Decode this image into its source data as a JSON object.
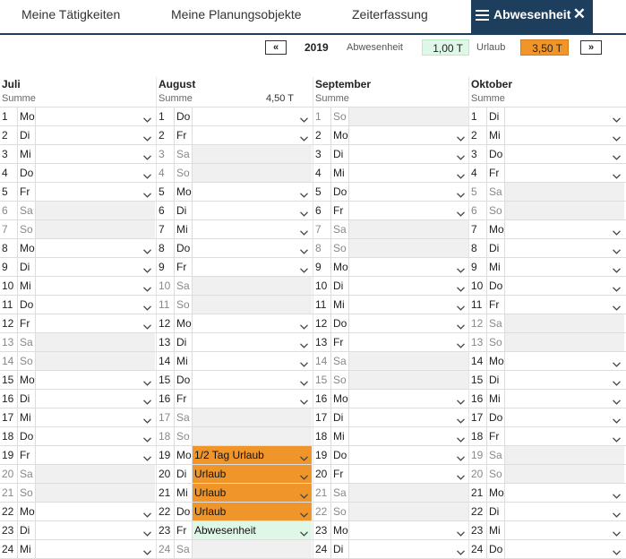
{
  "tabs": [
    {
      "label": "Meine Tätigkeiten",
      "active": false
    },
    {
      "label": "Meine Planungsobjekte",
      "active": false
    },
    {
      "label": "Zeiterfassung",
      "active": false
    },
    {
      "label": "Abwesenheit",
      "active": true
    }
  ],
  "toolbar": {
    "prev_label": "«",
    "year": "2019",
    "abwesenheit_label": "Abwesenheit",
    "abwesenheit_value": "1,00 T",
    "urlaub_label": "Urlaub",
    "urlaub_value": "3,50 T",
    "next_label": "»"
  },
  "colors": {
    "header_active": "#1d3e5c",
    "urlaub": "#f0952a",
    "abwesenheit": "#dff7e6",
    "weekend": "#f0f0f0"
  },
  "sum_label": "Summe",
  "months": [
    {
      "name": "Juli",
      "sum": "",
      "days": [
        {
          "d": "1",
          "wd": "Mo",
          "we": false,
          "value": ""
        },
        {
          "d": "2",
          "wd": "Di",
          "we": false,
          "value": ""
        },
        {
          "d": "3",
          "wd": "Mi",
          "we": false,
          "value": ""
        },
        {
          "d": "4",
          "wd": "Do",
          "we": false,
          "value": ""
        },
        {
          "d": "5",
          "wd": "Fr",
          "we": false,
          "value": ""
        },
        {
          "d": "6",
          "wd": "Sa",
          "we": true,
          "value": ""
        },
        {
          "d": "7",
          "wd": "So",
          "we": true,
          "value": ""
        },
        {
          "d": "8",
          "wd": "Mo",
          "we": false,
          "value": ""
        },
        {
          "d": "9",
          "wd": "Di",
          "we": false,
          "value": ""
        },
        {
          "d": "10",
          "wd": "Mi",
          "we": false,
          "value": ""
        },
        {
          "d": "11",
          "wd": "Do",
          "we": false,
          "value": ""
        },
        {
          "d": "12",
          "wd": "Fr",
          "we": false,
          "value": ""
        },
        {
          "d": "13",
          "wd": "Sa",
          "we": true,
          "value": ""
        },
        {
          "d": "14",
          "wd": "So",
          "we": true,
          "value": ""
        },
        {
          "d": "15",
          "wd": "Mo",
          "we": false,
          "value": ""
        },
        {
          "d": "16",
          "wd": "Di",
          "we": false,
          "value": ""
        },
        {
          "d": "17",
          "wd": "Mi",
          "we": false,
          "value": ""
        },
        {
          "d": "18",
          "wd": "Do",
          "we": false,
          "value": ""
        },
        {
          "d": "19",
          "wd": "Fr",
          "we": false,
          "value": ""
        },
        {
          "d": "20",
          "wd": "Sa",
          "we": true,
          "value": ""
        },
        {
          "d": "21",
          "wd": "So",
          "we": true,
          "value": ""
        },
        {
          "d": "22",
          "wd": "Mo",
          "we": false,
          "value": ""
        },
        {
          "d": "23",
          "wd": "Di",
          "we": false,
          "value": ""
        },
        {
          "d": "24",
          "wd": "Mi",
          "we": false,
          "value": ""
        }
      ]
    },
    {
      "name": "August",
      "sum": "4,50 T",
      "days": [
        {
          "d": "1",
          "wd": "Do",
          "we": false,
          "value": ""
        },
        {
          "d": "2",
          "wd": "Fr",
          "we": false,
          "value": ""
        },
        {
          "d": "3",
          "wd": "Sa",
          "we": true,
          "value": ""
        },
        {
          "d": "4",
          "wd": "So",
          "we": true,
          "value": ""
        },
        {
          "d": "5",
          "wd": "Mo",
          "we": false,
          "value": ""
        },
        {
          "d": "6",
          "wd": "Di",
          "we": false,
          "value": ""
        },
        {
          "d": "7",
          "wd": "Mi",
          "we": false,
          "value": ""
        },
        {
          "d": "8",
          "wd": "Do",
          "we": false,
          "value": ""
        },
        {
          "d": "9",
          "wd": "Fr",
          "we": false,
          "value": ""
        },
        {
          "d": "10",
          "wd": "Sa",
          "we": true,
          "value": ""
        },
        {
          "d": "11",
          "wd": "So",
          "we": true,
          "value": ""
        },
        {
          "d": "12",
          "wd": "Mo",
          "we": false,
          "value": ""
        },
        {
          "d": "13",
          "wd": "Di",
          "we": false,
          "value": ""
        },
        {
          "d": "14",
          "wd": "Mi",
          "we": false,
          "value": ""
        },
        {
          "d": "15",
          "wd": "Do",
          "we": false,
          "value": ""
        },
        {
          "d": "16",
          "wd": "Fr",
          "we": false,
          "value": ""
        },
        {
          "d": "17",
          "wd": "Sa",
          "we": true,
          "value": ""
        },
        {
          "d": "18",
          "wd": "So",
          "we": true,
          "value": ""
        },
        {
          "d": "19",
          "wd": "Mo",
          "we": false,
          "value": "1/2 Tag Urlaub",
          "kind": "urlaub"
        },
        {
          "d": "20",
          "wd": "Di",
          "we": false,
          "value": "Urlaub",
          "kind": "urlaub"
        },
        {
          "d": "21",
          "wd": "Mi",
          "we": false,
          "value": "Urlaub",
          "kind": "urlaub"
        },
        {
          "d": "22",
          "wd": "Do",
          "we": false,
          "value": "Urlaub",
          "kind": "urlaub"
        },
        {
          "d": "23",
          "wd": "Fr",
          "we": false,
          "value": "Abwesenheit",
          "kind": "abw"
        },
        {
          "d": "24",
          "wd": "Sa",
          "we": true,
          "value": ""
        }
      ]
    },
    {
      "name": "September",
      "sum": "",
      "days": [
        {
          "d": "1",
          "wd": "So",
          "we": true,
          "value": ""
        },
        {
          "d": "2",
          "wd": "Mo",
          "we": false,
          "value": ""
        },
        {
          "d": "3",
          "wd": "Di",
          "we": false,
          "value": ""
        },
        {
          "d": "4",
          "wd": "Mi",
          "we": false,
          "value": ""
        },
        {
          "d": "5",
          "wd": "Do",
          "we": false,
          "value": ""
        },
        {
          "d": "6",
          "wd": "Fr",
          "we": false,
          "value": ""
        },
        {
          "d": "7",
          "wd": "Sa",
          "we": true,
          "value": ""
        },
        {
          "d": "8",
          "wd": "So",
          "we": true,
          "value": ""
        },
        {
          "d": "9",
          "wd": "Mo",
          "we": false,
          "value": ""
        },
        {
          "d": "10",
          "wd": "Di",
          "we": false,
          "value": ""
        },
        {
          "d": "11",
          "wd": "Mi",
          "we": false,
          "value": ""
        },
        {
          "d": "12",
          "wd": "Do",
          "we": false,
          "value": ""
        },
        {
          "d": "13",
          "wd": "Fr",
          "we": false,
          "value": ""
        },
        {
          "d": "14",
          "wd": "Sa",
          "we": true,
          "value": ""
        },
        {
          "d": "15",
          "wd": "So",
          "we": true,
          "value": ""
        },
        {
          "d": "16",
          "wd": "Mo",
          "we": false,
          "value": ""
        },
        {
          "d": "17",
          "wd": "Di",
          "we": false,
          "value": ""
        },
        {
          "d": "18",
          "wd": "Mi",
          "we": false,
          "value": ""
        },
        {
          "d": "19",
          "wd": "Do",
          "we": false,
          "value": ""
        },
        {
          "d": "20",
          "wd": "Fr",
          "we": false,
          "value": ""
        },
        {
          "d": "21",
          "wd": "Sa",
          "we": true,
          "value": ""
        },
        {
          "d": "22",
          "wd": "So",
          "we": true,
          "value": ""
        },
        {
          "d": "23",
          "wd": "Mo",
          "we": false,
          "value": ""
        },
        {
          "d": "24",
          "wd": "Di",
          "we": false,
          "value": ""
        }
      ]
    },
    {
      "name": "Oktober",
      "sum": "",
      "days": [
        {
          "d": "1",
          "wd": "Di",
          "we": false,
          "value": ""
        },
        {
          "d": "2",
          "wd": "Mi",
          "we": false,
          "value": ""
        },
        {
          "d": "3",
          "wd": "Do",
          "we": false,
          "value": ""
        },
        {
          "d": "4",
          "wd": "Fr",
          "we": false,
          "value": ""
        },
        {
          "d": "5",
          "wd": "Sa",
          "we": true,
          "value": ""
        },
        {
          "d": "6",
          "wd": "So",
          "we": true,
          "value": ""
        },
        {
          "d": "7",
          "wd": "Mo",
          "we": false,
          "value": ""
        },
        {
          "d": "8",
          "wd": "Di",
          "we": false,
          "value": ""
        },
        {
          "d": "9",
          "wd": "Mi",
          "we": false,
          "value": ""
        },
        {
          "d": "10",
          "wd": "Do",
          "we": false,
          "value": ""
        },
        {
          "d": "11",
          "wd": "Fr",
          "we": false,
          "value": ""
        },
        {
          "d": "12",
          "wd": "Sa",
          "we": true,
          "value": ""
        },
        {
          "d": "13",
          "wd": "So",
          "we": true,
          "value": ""
        },
        {
          "d": "14",
          "wd": "Mo",
          "we": false,
          "value": ""
        },
        {
          "d": "15",
          "wd": "Di",
          "we": false,
          "value": ""
        },
        {
          "d": "16",
          "wd": "Mi",
          "we": false,
          "value": ""
        },
        {
          "d": "17",
          "wd": "Do",
          "we": false,
          "value": ""
        },
        {
          "d": "18",
          "wd": "Fr",
          "we": false,
          "value": ""
        },
        {
          "d": "19",
          "wd": "Sa",
          "we": true,
          "value": ""
        },
        {
          "d": "20",
          "wd": "So",
          "we": true,
          "value": ""
        },
        {
          "d": "21",
          "wd": "Mo",
          "we": false,
          "value": ""
        },
        {
          "d": "22",
          "wd": "Di",
          "we": false,
          "value": ""
        },
        {
          "d": "23",
          "wd": "Mi",
          "we": false,
          "value": ""
        },
        {
          "d": "24",
          "wd": "Do",
          "we": false,
          "value": ""
        }
      ]
    }
  ]
}
